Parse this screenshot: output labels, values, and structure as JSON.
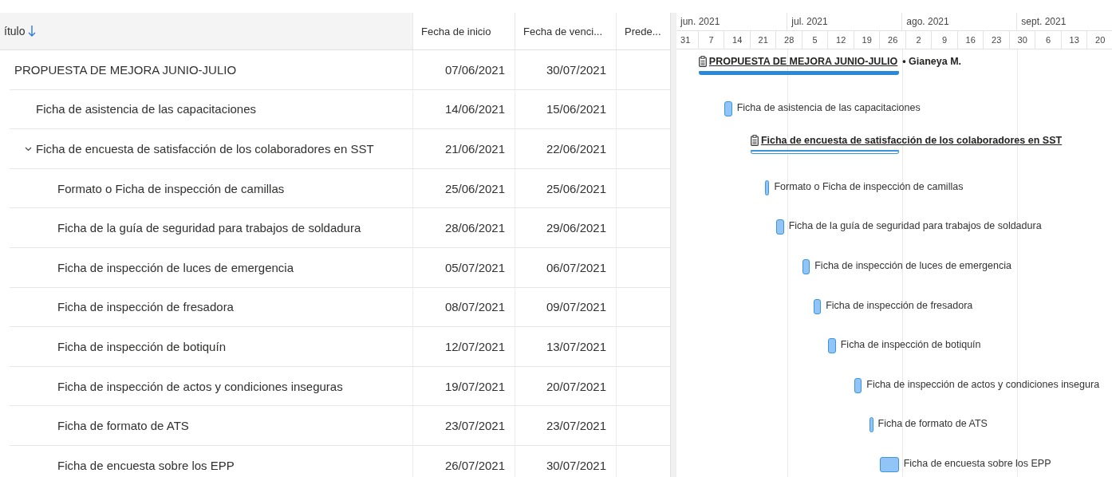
{
  "table": {
    "columns": [
      {
        "label": "ítulo",
        "sorted": true
      },
      {
        "label": "Fecha de inicio",
        "sorted": false
      },
      {
        "label": "Fecha de venci...",
        "sorted": false
      },
      {
        "label": "Prede...",
        "sorted": false
      }
    ]
  },
  "timeline": {
    "months": [
      "jun. 2021",
      "jul. 2021",
      "ago. 2021",
      "sept. 2021"
    ],
    "weeks": [
      "31",
      "7",
      "14",
      "21",
      "28",
      "5",
      "12",
      "19",
      "26",
      "2",
      "9",
      "16",
      "23",
      "30",
      "6",
      "13",
      "20"
    ]
  },
  "tasks": [
    {
      "title": "PROPUESTA DE MEJORA JUNIO-JULIO",
      "start": "07/06/2021",
      "due": "30/07/2021",
      "gantt_label": "PROPUESTA DE MEJORA JUNIO-JULIO",
      "assignee": "• Gianeya M.",
      "children": [
        {
          "title": "Ficha de asistencia de las capacitaciones",
          "start": "14/06/2021",
          "due": "15/06/2021",
          "gantt_label": "Ficha de asistencia de las capacitaciones"
        },
        {
          "title": "Ficha de encuesta de satisfacción de los colaboradores en SST",
          "start": "21/06/2021",
          "due": "22/06/2021",
          "gantt_label": "Ficha de encuesta de satisfacción de los colaboradores en SST",
          "expanded": true,
          "children": [
            {
              "title": "Formato o Ficha de inspección de camillas",
              "start": "25/06/2021",
              "due": "25/06/2021",
              "gantt_label": "Formato o Ficha de inspección de camillas"
            },
            {
              "title": "Ficha de la guía de seguridad para trabajos de soldadura",
              "start": "28/06/2021",
              "due": "29/06/2021",
              "gantt_label": "Ficha de la guía de seguridad para trabajos de soldadura"
            },
            {
              "title": "Ficha de inspección de luces de emergencia",
              "start": "05/07/2021",
              "due": "06/07/2021",
              "gantt_label": "Ficha de inspección de luces de emergencia"
            },
            {
              "title": "Ficha de inspección de fresadora",
              "start": "08/07/2021",
              "due": "09/07/2021",
              "gantt_label": "Ficha de inspección de fresadora"
            },
            {
              "title": "Ficha de inspección de botiquín",
              "start": "12/07/2021",
              "due": "13/07/2021",
              "gantt_label": "Ficha de inspección de botiquín"
            },
            {
              "title": "Ficha de inspección de actos y condiciones inseguras",
              "start": "19/07/2021",
              "due": "20/07/2021",
              "gantt_label": "Ficha de inspección de actos y condiciones insegura"
            },
            {
              "title": "Ficha de formato de ATS",
              "start": "23/07/2021",
              "due": "23/07/2021",
              "gantt_label": "Ficha de formato de ATS"
            },
            {
              "title": "Ficha de encuesta sobre los EPP",
              "start": "26/07/2021",
              "due": "30/07/2021",
              "gantt_label": "Ficha de encuesta sobre los EPP"
            }
          ]
        }
      ]
    }
  ]
}
